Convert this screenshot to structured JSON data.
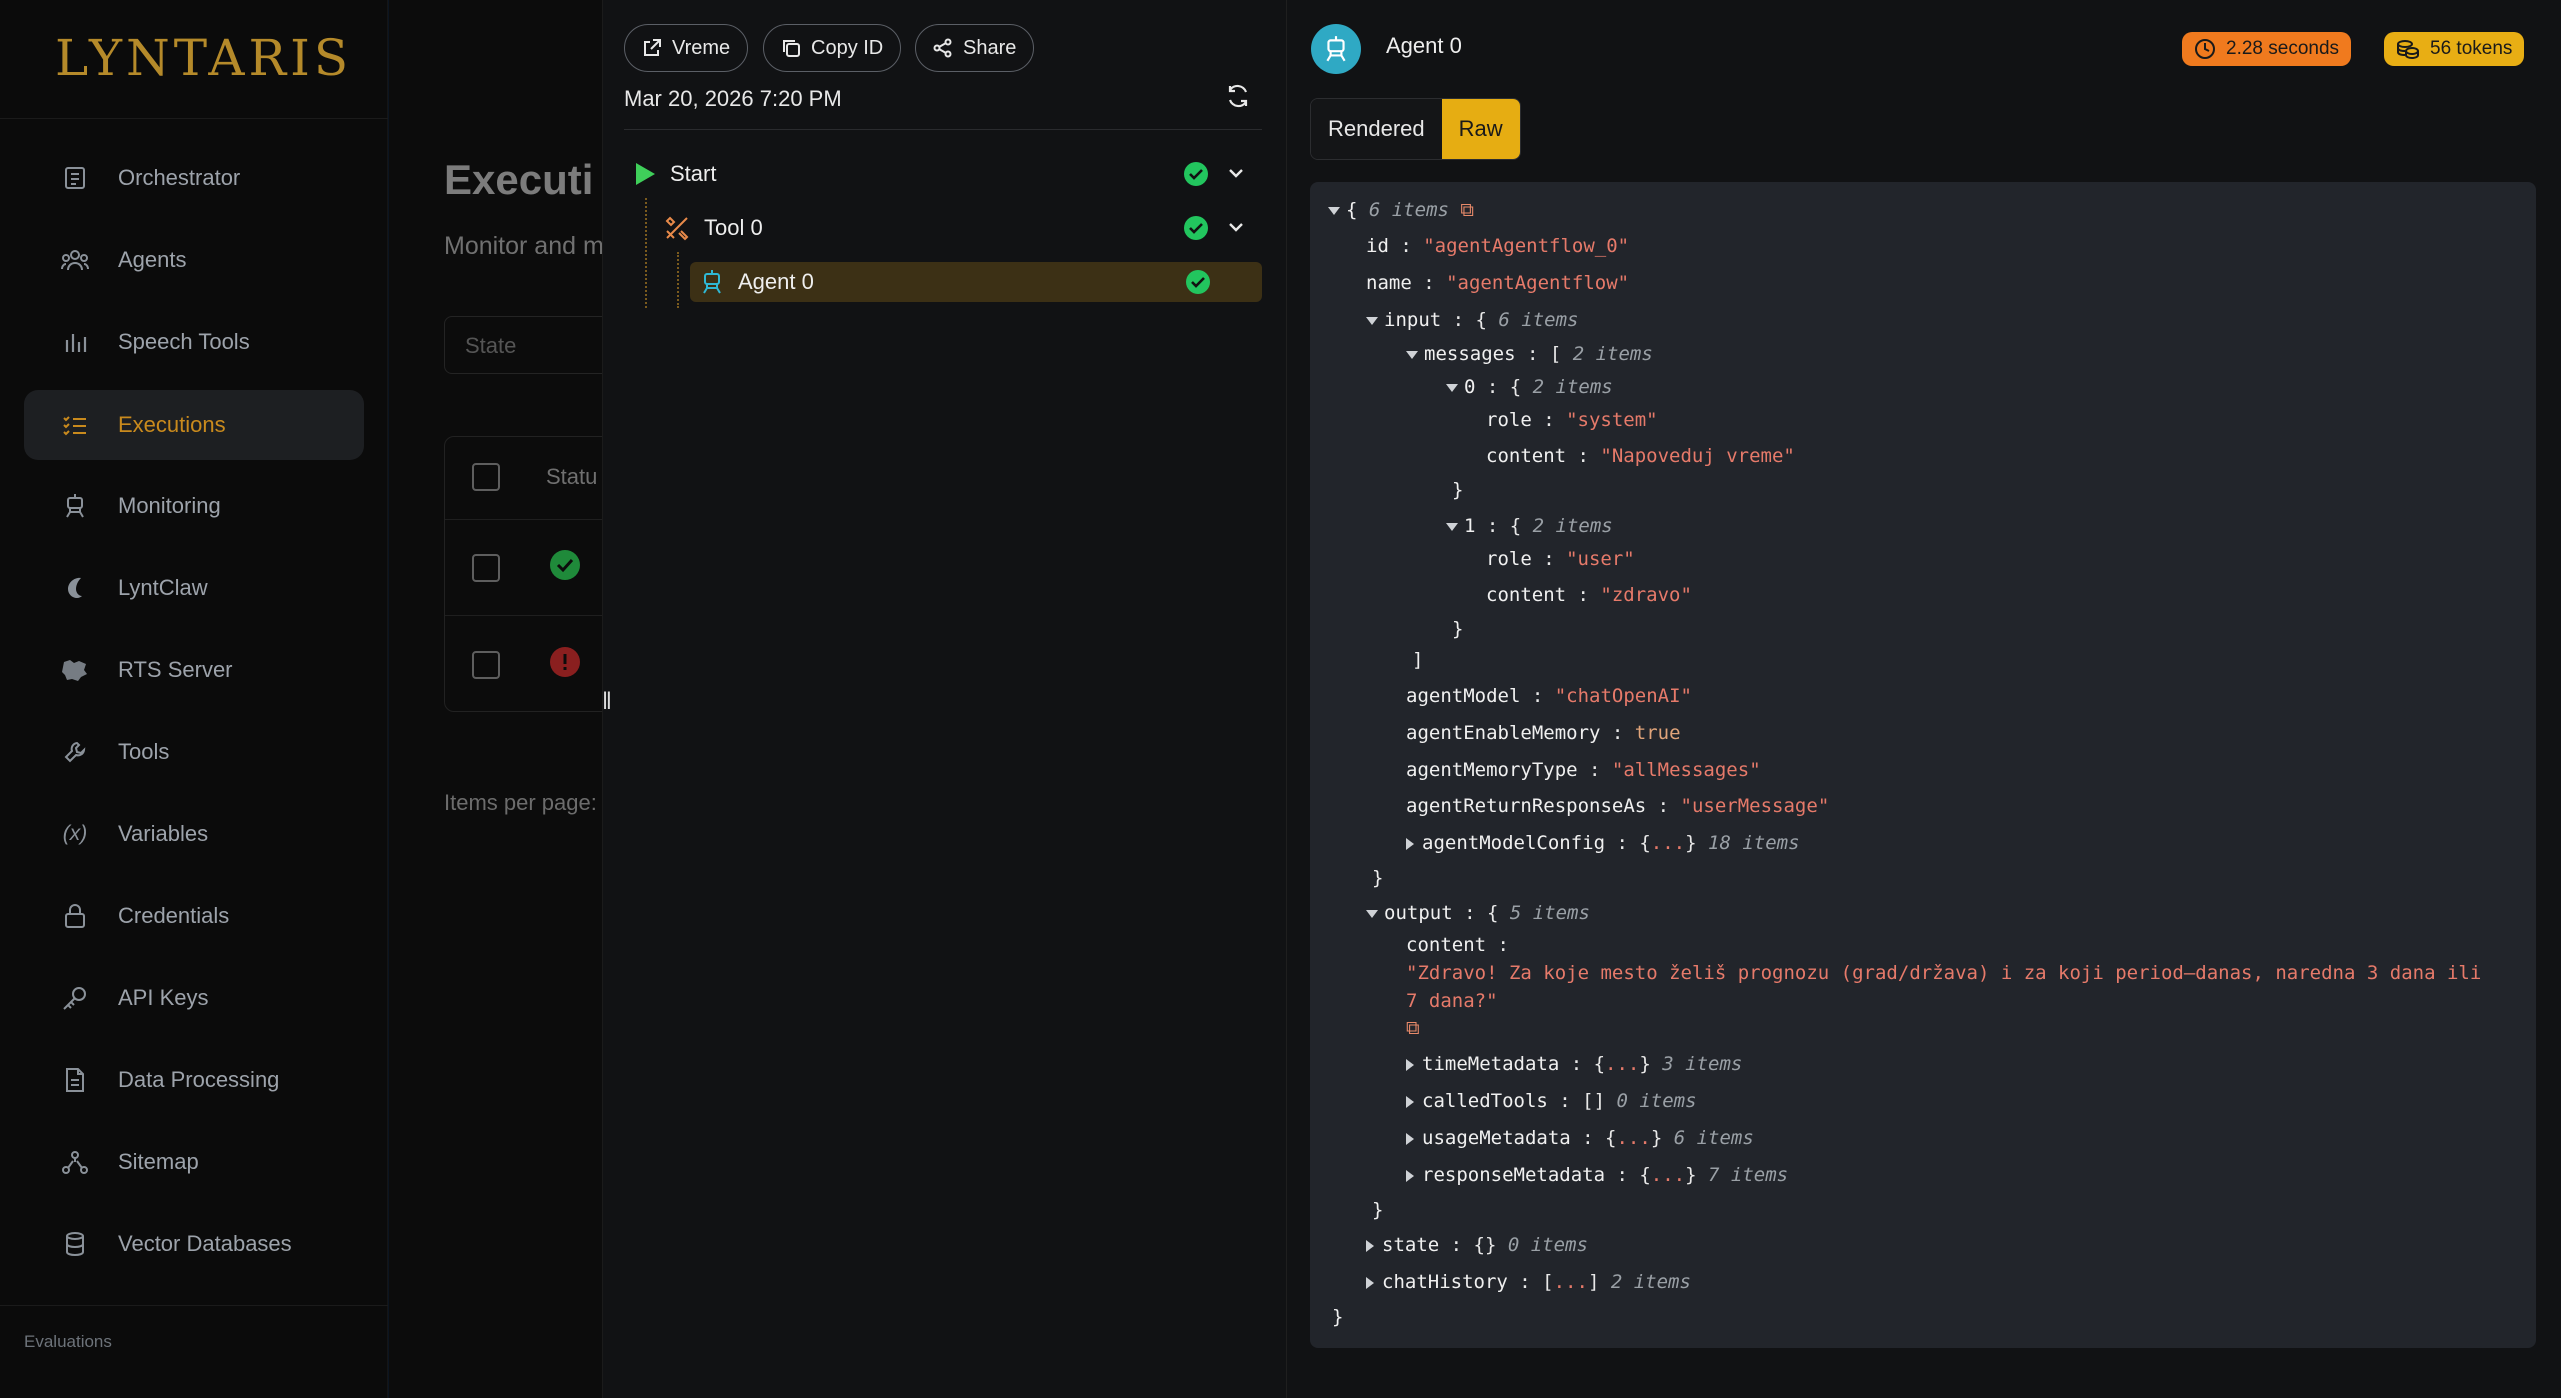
{
  "app": {
    "logo": "LYNTARIS"
  },
  "sidebar": {
    "items": [
      {
        "label": "Orchestrator",
        "icon": "orchestrator-icon"
      },
      {
        "label": "Agents",
        "icon": "agents-icon"
      },
      {
        "label": "Speech Tools",
        "icon": "bar-chart-icon"
      },
      {
        "label": "Executions",
        "icon": "list-check-icon",
        "active": true
      },
      {
        "label": "Monitoring",
        "icon": "robot-icon"
      },
      {
        "label": "LyntClaw",
        "icon": "claw-icon"
      },
      {
        "label": "RTS Server",
        "icon": "server-icon"
      },
      {
        "label": "Tools",
        "icon": "wrench-icon"
      },
      {
        "label": "Variables",
        "icon": "variable-icon"
      },
      {
        "label": "Credentials",
        "icon": "lock-icon"
      },
      {
        "label": "API Keys",
        "icon": "key-icon"
      },
      {
        "label": "Data Processing",
        "icon": "document-icon"
      },
      {
        "label": "Sitemap",
        "icon": "sitemap-icon"
      },
      {
        "label": "Vector Databases",
        "icon": "database-icon"
      }
    ],
    "section_label": "Evaluations"
  },
  "main": {
    "title": "Executi",
    "subtitle": "Monitor and m",
    "state_placeholder": "State",
    "table": {
      "status_header": "Statu"
    },
    "items_per_page": "Items per page:"
  },
  "middle": {
    "buttons": {
      "vreme": "Vreme",
      "copy_id": "Copy ID",
      "share": "Share"
    },
    "date": "Mar 20, 2026 7:20 PM",
    "tree": {
      "start": "Start",
      "tool": "Tool 0",
      "agent": "Agent 0"
    }
  },
  "right": {
    "title": "Agent 0",
    "duration": "2.28 seconds",
    "tokens": "56 tokens",
    "tabs": {
      "rendered": "Rendered",
      "raw": "Raw"
    },
    "colors": {
      "duration_pill": "#f07a1e",
      "tokens_pill": "#e8ae14",
      "accent": "#e6ad12",
      "agent_icon": "#2fa9c4"
    }
  },
  "json": {
    "root_count": "6 items",
    "id_key": "id",
    "id_val": "\"agentAgentflow_0\"",
    "name_key": "name",
    "name_val": "\"agentAgentflow\"",
    "input_key": "input",
    "input_count": "6 items",
    "messages_key": "messages",
    "messages_count": "2 items",
    "m0_key": "0",
    "m0_count": "2 items",
    "role_key": "role",
    "m0_role": "\"system\"",
    "content_key": "content",
    "m0_content": "\"Napoveduj vreme\"",
    "m1_key": "1",
    "m1_count": "2 items",
    "m1_role": "\"user\"",
    "m1_content": "\"zdravo\"",
    "agentModel_key": "agentModel",
    "agentModel_val": "\"chatOpenAI\"",
    "agentEnableMemory_key": "agentEnableMemory",
    "agentEnableMemory_val": "true",
    "agentMemoryType_key": "agentMemoryType",
    "agentMemoryType_val": "\"allMessages\"",
    "agentReturnResponseAs_key": "agentReturnResponseAs",
    "agentReturnResponseAs_val": "\"userMessage\"",
    "agentModelConfig_key": "agentModelConfig",
    "agentModelConfig_count": "18 items",
    "output_key": "output",
    "output_count": "5 items",
    "output_content_line1": "\"Zdravo! Za koje mesto želiš prognozu (grad/država) i za koji period—danas, naredna 3 dana ili",
    "output_content_line2": "7 dana?\"",
    "timeMetadata_key": "timeMetadata",
    "timeMetadata_count": "3 items",
    "calledTools_key": "calledTools",
    "calledTools_count": "0 items",
    "usageMetadata_key": "usageMetadata",
    "usageMetadata_count": "6 items",
    "responseMetadata_key": "responseMetadata",
    "responseMetadata_count": "7 items",
    "state_key": "state",
    "state_count": "0 items",
    "chatHistory_key": "chatHistory",
    "chatHistory_count": "2 items"
  }
}
